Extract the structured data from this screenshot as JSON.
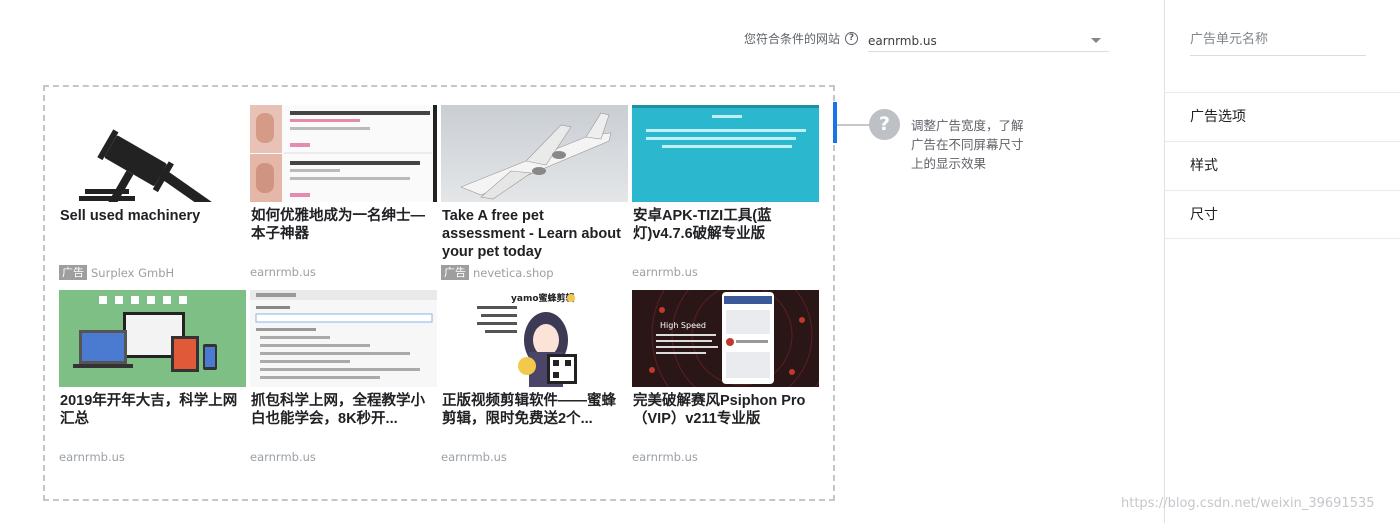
{
  "site_selector": {
    "label": "您符合条件的网站",
    "value": "earnrmb.us"
  },
  "hint": {
    "text": "调整广告宽度，了解广告在不同屏幕尺寸上的显示效果"
  },
  "panel": {
    "name_placeholder": "广告单元名称",
    "menu": [
      "广告选项",
      "样式",
      "尺寸"
    ]
  },
  "cards": [
    {
      "title": "Sell used machinery",
      "badge": "广告",
      "source": "Surplex GmbH"
    },
    {
      "title": "如何优雅地成为一名绅士—本子神器",
      "badge": "",
      "source": "earnrmb.us"
    },
    {
      "title": "Take A free pet assessment - Learn about your pet today",
      "badge": "广告",
      "source": "nevetica.shop"
    },
    {
      "title": "安卓APK-TIZI工具(蓝灯)v4.7.6破解专业版",
      "badge": "",
      "source": "earnrmb.us"
    },
    {
      "title": "2019年开年大吉，科学上网汇总",
      "badge": "",
      "source": "earnrmb.us"
    },
    {
      "title": "抓包科学上网，全程教学小白也能学会，8K秒开...",
      "badge": "",
      "source": "earnrmb.us"
    },
    {
      "title": "正版视频剪辑软件——蜜蜂剪辑，限时免费送2个...",
      "badge": "",
      "source": "earnrmb.us"
    },
    {
      "title": "完美破解赛风Psiphon Pro（VIP）v211专业版",
      "badge": "",
      "source": "earnrmb.us"
    }
  ],
  "thumb_text": {
    "psiphon_heading": "High Speed",
    "bee_brand": "yamo蜜蜂剪辑"
  },
  "watermark": "https://blog.csdn.net/weixin_39691535"
}
